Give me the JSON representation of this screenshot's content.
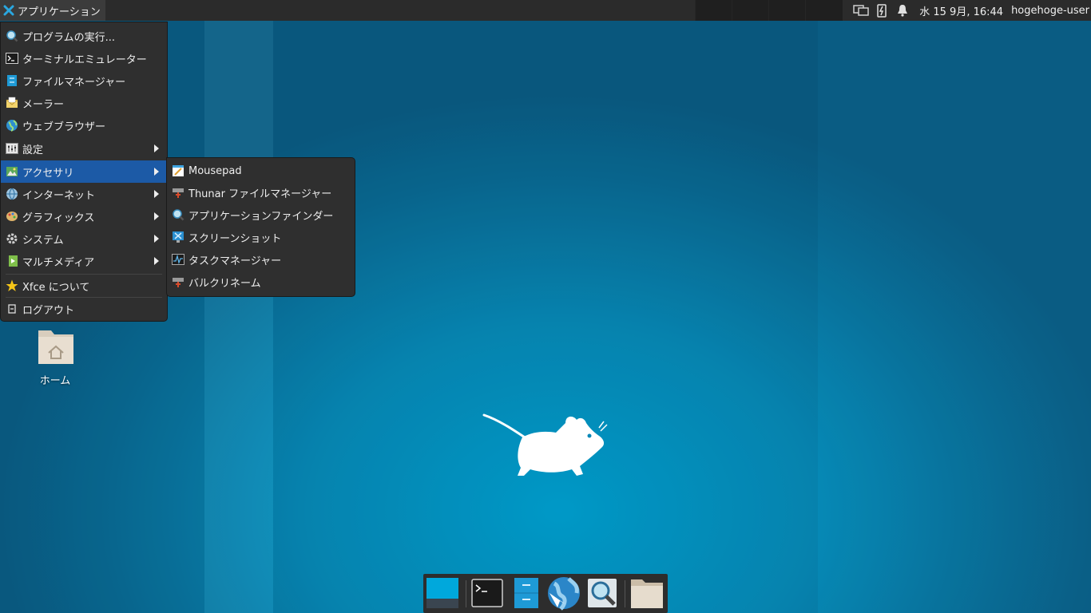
{
  "top_panel": {
    "apps_label": "アプリケーション",
    "clock": "水 15  9月, 16:44",
    "user": "hogehoge-user"
  },
  "main_menu": {
    "items": [
      {
        "label": "プログラムの実行...",
        "icon": "search-icon"
      },
      {
        "label": "ターミナルエミュレーター",
        "icon": "terminal-icon"
      },
      {
        "label": "ファイルマネージャー",
        "icon": "file-manager-icon"
      },
      {
        "label": "メーラー",
        "icon": "mail-icon"
      },
      {
        "label": "ウェブブラウザー",
        "icon": "globe-icon"
      },
      {
        "label": "設定",
        "icon": "settings-icon",
        "submenu": true
      },
      {
        "label": "アクセサリ",
        "icon": "accessories-icon",
        "submenu": true,
        "selected": true
      },
      {
        "label": "インターネット",
        "icon": "internet-icon",
        "submenu": true
      },
      {
        "label": "グラフィックス",
        "icon": "graphics-icon",
        "submenu": true
      },
      {
        "label": "システム",
        "icon": "system-gear-icon",
        "submenu": true
      },
      {
        "label": "マルチメディア",
        "icon": "multimedia-icon",
        "submenu": true
      },
      {
        "label": "Xfce について",
        "icon": "star-icon"
      },
      {
        "label": "ログアウト",
        "icon": "logout-icon"
      }
    ]
  },
  "sub_menu": {
    "items": [
      {
        "label": "Mousepad",
        "icon": "text-editor-icon"
      },
      {
        "label": "Thunar ファイルマネージャー",
        "icon": "thunar-icon"
      },
      {
        "label": "アプリケーションファインダー",
        "icon": "app-finder-icon"
      },
      {
        "label": "スクリーンショット",
        "icon": "screenshot-icon"
      },
      {
        "label": "タスクマネージャー",
        "icon": "task-manager-icon"
      },
      {
        "label": "バルクリネーム",
        "icon": "bulk-rename-icon"
      }
    ]
  },
  "desktop": {
    "home_label": "ホーム"
  },
  "colors": {
    "panel": "#2b2b2b",
    "menu": "#2f2f2f",
    "selected": "#1c5aa6",
    "accent": "#00a8d8"
  }
}
